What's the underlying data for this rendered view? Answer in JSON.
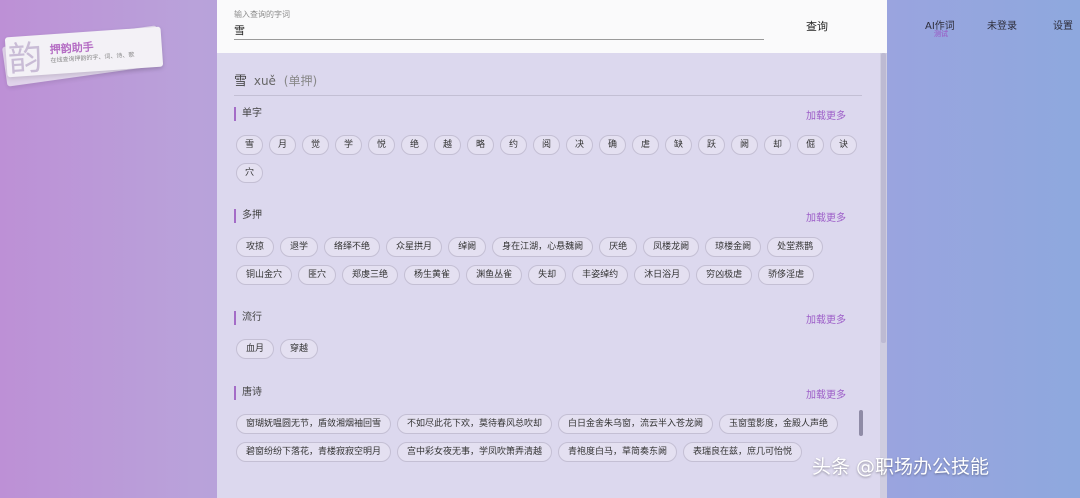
{
  "logo": {
    "glyph": "韵",
    "title": "押韵助手",
    "subtitle": "在线查询押韵的字、词、诗、歌"
  },
  "nav": {
    "ai_label": "AI作词",
    "ai_badge": "测试",
    "login_label": "未登录",
    "settings_label": "设置"
  },
  "search": {
    "label": "输入查询的字词",
    "value": "雪",
    "button_label": "查询"
  },
  "result": {
    "word": "雪",
    "pinyin": "xuě",
    "type": "(单押)"
  },
  "sections": [
    {
      "title": "单字",
      "more_label": "加载更多",
      "items": [
        "雪",
        "月",
        "觉",
        "学",
        "悦",
        "绝",
        "越",
        "略",
        "约",
        "阅",
        "决",
        "确",
        "虐",
        "缺",
        "跃",
        "阙",
        "却",
        "倔",
        "诀",
        "穴"
      ]
    },
    {
      "title": "多押",
      "more_label": "加载更多",
      "items": [
        "攻掠",
        "退学",
        "络绎不绝",
        "众星拱月",
        "绰阙",
        "身在江湖，心悬魏阙",
        "厌绝",
        "凤楼龙阙",
        "琼楼金阙",
        "处堂燕鹊",
        "铜山金穴",
        "匪穴",
        "郑虔三绝",
        "杨生黄雀",
        "渊鱼丛雀",
        "失却",
        "丰姿绰约",
        "沐日浴月",
        "穷凶极虐",
        "骄侈淫虐"
      ]
    },
    {
      "title": "流行",
      "more_label": "加载更多",
      "items": [
        "血月",
        "穿越"
      ]
    },
    {
      "title": "唐诗",
      "more_label": "加载更多",
      "items": [
        "窗瑚妩嗢圆无节，盾敛湘烟袖回雪",
        "不如尽此花下欢，莫待春风总吹却",
        "白日金舍朱乌窗，流云半入苍龙阙",
        "玉窗萤影度，金殿人声绝",
        "碧窗纷纷下落花，青楼寂寂空明月",
        "宫中彩女夜无事，学凤吹箫弄清越",
        "青袍度白马，草简奏东阙",
        "表瑞良在兹，庶几可怡悦"
      ]
    }
  ],
  "watermark": "头条 @职场办公技能"
}
